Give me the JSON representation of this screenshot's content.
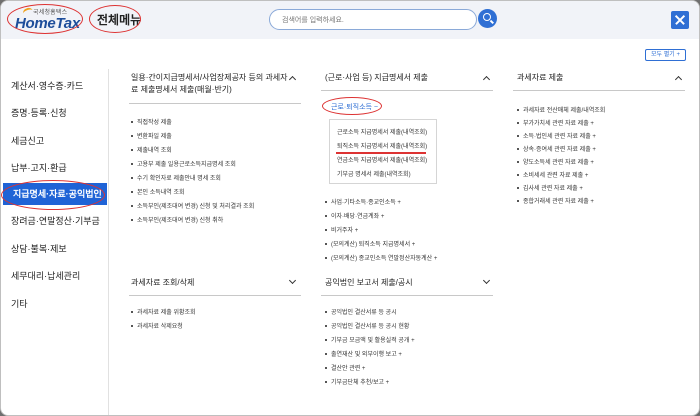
{
  "header": {
    "logo_small": "국세청홈택스",
    "logo_big": "HomeTax",
    "menu_title": "전체메뉴",
    "search_placeholder": "검색어를 입력하세요.",
    "expand_all": "모두 펼기 +"
  },
  "sidebar": {
    "items": [
      {
        "label": "계산서·영수증·카드"
      },
      {
        "label": "증명·등록·신청"
      },
      {
        "label": "세금신고"
      },
      {
        "label": "납부·고지·환급"
      },
      {
        "label": "지급명세·자료·공익법인"
      },
      {
        "label": "장려금·연말정산·기부금"
      },
      {
        "label": "상담·불복·제보"
      },
      {
        "label": "세무대리·납세관리"
      },
      {
        "label": "기타"
      }
    ],
    "active_index": 4
  },
  "columns": [
    {
      "title": "일용·간이지급명세서/사업장제공자 등의 과세자료 제출명세서 제출(매월·반기)",
      "items": [
        "직접작성 제출",
        "변환파일 제출",
        "제출내역 조회",
        "고용부 제출 일용근로소득지급명세 조회",
        "수기 확인자료 제출안내 명세 조회",
        "본인 소득내역 조회",
        "소득부인(제조대여 변경) 신청 및 처리결과 조회",
        "소득부인(제조대여 변경) 신청 취하"
      ]
    },
    {
      "title": "(근로·사업 등) 지급명세서 제출",
      "expanded_label": "근로·퇴직소득 −",
      "submenu": [
        "근로소득 지급명세서 제출(내역조회)",
        "퇴직소득 지급명세서 제출(내역조회)",
        "연금소득 지급명세서 제출(내역조회)",
        "기부금 명세서 제출(내역조회)"
      ],
      "items": [
        "사업·기타소득·종교인소득 +",
        "이자·배당·연금계좌 +",
        "비거주자 +",
        "(모의계산) 퇴직소득 지급명세서 +",
        "(모의계산) 종교인소득 연말정산자동계산 +"
      ]
    },
    {
      "title": "과세자료 제출",
      "items": [
        "과세자료 전산매체 제출/내역조회",
        "부가가치세 관련 자료 제출 +",
        "소득·법인세 관련 자료 제출 +",
        "상속·증여세 관련 자료 제출 +",
        "양도소득세 관련 자료 제출 +",
        "소비세세 관련 자료 제출 +",
        "김사세 관련 자료 제출 +",
        "종합거래세 관련 자료 제출 +"
      ]
    },
    {
      "title": "과세자료 조회/삭제",
      "items": [
        "과세자료 제출 위황조회",
        "과세자료 삭제요청"
      ]
    },
    {
      "title": "공익법인 보고서 제출/공시",
      "items": [
        "공익법인 결산서류 등 공시",
        "공익법인 결산서류 등 공시 현황",
        "기부금 모금액 및 활용실적 공개 +",
        "출연재산 및 외부이행 보고 +",
        "결산안 관련 +",
        "기부금단체 추천/보고 +"
      ]
    }
  ],
  "colors": {
    "accent": "#1f63d6",
    "annotation_red": "#dd3333"
  }
}
